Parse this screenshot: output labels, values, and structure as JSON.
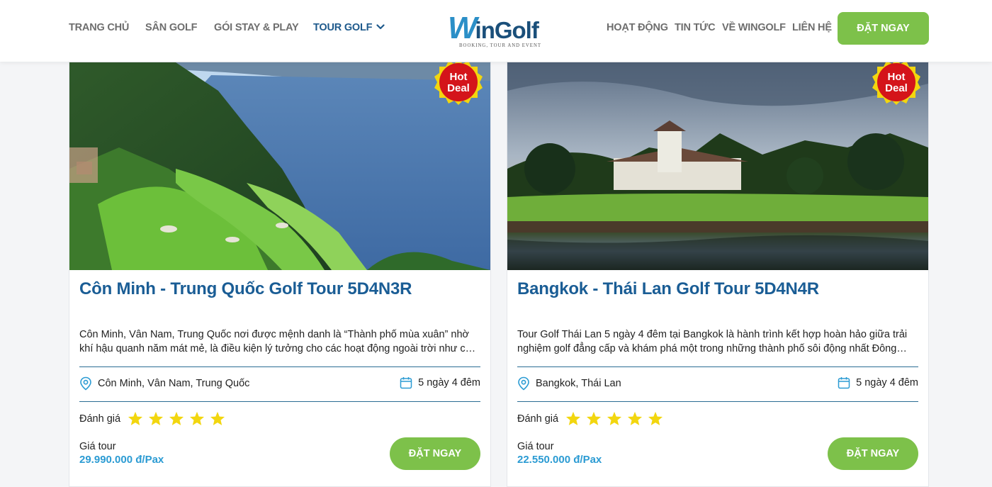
{
  "nav": {
    "left": [
      "TRANG CHỦ",
      "SÂN GOLF",
      "GÓI STAY & PLAY",
      "TOUR GOLF"
    ],
    "right": [
      "HOẠT ĐỘNG",
      "TIN TỨC",
      "VỀ WINGOLF",
      "LIÊN HỆ"
    ],
    "active": "TOUR GOLF",
    "cta": "ĐẶT NGAY"
  },
  "logo": {
    "first_letter": "W",
    "rest": "inGolf",
    "tagline": "BOOKING, TOUR AND EVENT"
  },
  "cards": [
    {
      "title": "Côn Minh - Trung Quốc Golf Tour 5D4N3R",
      "badge": [
        "Hot",
        "Deal"
      ],
      "description": "Côn Minh, Vân Nam, Trung Quốc nơi được mệnh danh là “Thành phố mùa xuân” nhờ khí hậu quanh năm mát mẻ, là điều kiện lý tưởng cho các hoạt động ngoài trời như chơi golf, tham quan và nghỉ dưỡng.",
      "location": "Côn Minh, Vân Nam, Trung Quốc",
      "duration": "5 ngày 4 đêm",
      "rating_label": "Đánh giá",
      "stars": 5,
      "price_label": "Giá tour",
      "price": "29.990.000 đ/Pax",
      "cta": "ĐẶT NGAY"
    },
    {
      "title": "Bangkok - Thái Lan Golf Tour 5D4N4R",
      "badge": [
        "Hot",
        "Deal"
      ],
      "description": "Tour Golf Thái Lan 5 ngày 4 đêm tại Bangkok là hành trình kết hợp hoàn hảo giữa trải nghiệm golf đẳng cấp và khám phá một trong những thành phố sôi động nhất Đông Nam Á.",
      "location": "Bangkok, Thái Lan",
      "duration": "5 ngày 4 đêm",
      "rating_label": "Đánh giá",
      "stars": 5,
      "price_label": "Giá tour",
      "price": "22.550.000 đ/Pax",
      "cta": "ĐẶT NGAY"
    }
  ],
  "colors": {
    "brand_blue": "#1a5d95",
    "accent_green": "#7dc14a",
    "price_blue": "#2b9bd3",
    "badge_red": "#d4141a",
    "star_yellow": "#f2d60f"
  },
  "icons": [
    "chevron-down-icon",
    "location-pin-icon",
    "calendar-icon",
    "star-icon"
  ]
}
